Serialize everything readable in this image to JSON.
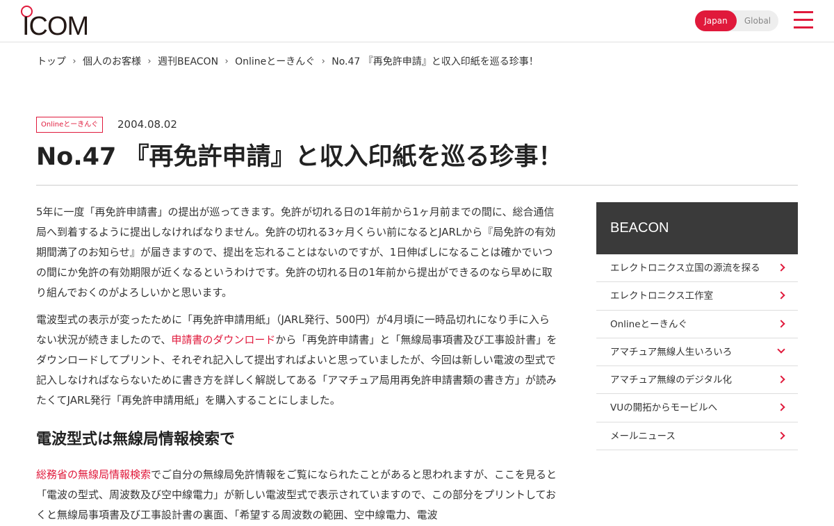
{
  "header": {
    "logo_text": "ICOM",
    "region": {
      "japan": "Japan",
      "global": "Global"
    },
    "colors": {
      "accent": "#e0193b"
    }
  },
  "breadcrumb": {
    "items": [
      "トップ",
      "個人のお客様",
      "週刊BEACON",
      "Onlineとーきんぐ",
      "No.47 『再免許申請』と収入印紙を巡る珍事！"
    ],
    "separator_icon": "chevron-right-icon"
  },
  "article_meta": {
    "tag": "Onlineとーきんぐ",
    "date": "2004.08.02",
    "title": "No.47 『再免許申請』と収入印紙を巡る珍事！"
  },
  "article": {
    "p1": "5年に一度「再免許申請書」の提出が巡ってきます。免許が切れる日の1年前から1ヶ月前までの間に、総合通信局へ到着するように提出しなければなりません。免許の切れる3ヶ月くらい前になるとJARLから『局免許の有効期間満了のお知らせ』が届きますので、提出を忘れることはないのですが、1日伸ばしになることは確かでいつの間にか免許の有効期限が近くなるというわけです。免許の切れる日の1年前から提出ができるのなら早めに取り組んでおくのがよろしいかと思います。",
    "p2_a": "電波型式の表示が変ったために「再免許申請用紙」（JARL発行、500円）が4月頃に一時品切れになり手に入らない状況が続きましたので、",
    "p2_link": "申請書のダウンロード",
    "p2_b": "から「再免許申請書」と「無線局事項書及び工事設計書」をダウンロードしてプリント、それぞれ記入して提出すればよいと思っていましたが、今回は新しい電波の型式で記入しなければならないために書き方を詳しく解説してある「アマチュア局用再免許申請書類の書き方」が読みたくてJARL発行「再免許申請用紙」を購入することにしました。",
    "h2": "電波型式は無線局情報検索で",
    "p3_link": "総務省の無線局情報検索",
    "p3_b": "でご自分の無線局免許情報をご覧になられたことがあると思われますが、ここを見ると「電波の型式、周波数及び空中線電力」が新しい電波型式で表示されていますので、この部分をプリントしておくと無線局事項書及び工事設計書の裏面、「希望する周波数の範囲、空中線電力、電波"
  },
  "sidebar": {
    "title": "BEACON",
    "items": [
      {
        "label": "エレクトロニクス立国の源流を探る",
        "icon": "chevron-right-icon"
      },
      {
        "label": "エレクトロニクス工作室",
        "icon": "chevron-right-icon"
      },
      {
        "label": "Onlineとーきんぐ",
        "icon": "chevron-right-icon"
      },
      {
        "label": "アマチュア無線人生いろいろ",
        "icon": "chevron-down-icon"
      },
      {
        "label": "アマチュア無線のデジタル化",
        "icon": "chevron-right-icon"
      },
      {
        "label": "VUの開拓からモービルへ",
        "icon": "chevron-right-icon"
      },
      {
        "label": "メールニュース",
        "icon": "chevron-right-icon"
      }
    ]
  }
}
